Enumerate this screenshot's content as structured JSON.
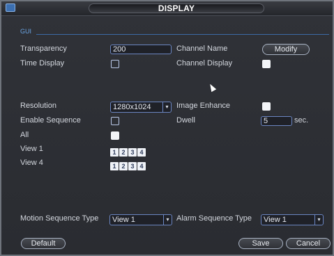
{
  "window": {
    "title": "DISPLAY"
  },
  "section": {
    "label": "GUI"
  },
  "fields": {
    "transparency": {
      "label": "Transparency",
      "value": "200"
    },
    "channel_name": {
      "label": "Channel Name",
      "button": "Modify"
    },
    "time_display": {
      "label": "Time Display",
      "checked": false
    },
    "channel_display": {
      "label": "Channel Display",
      "checked": true
    },
    "resolution": {
      "label": "Resolution",
      "value": "1280x1024"
    },
    "image_enhance": {
      "label": "Image Enhance",
      "checked": true
    },
    "enable_sequence": {
      "label": "Enable Sequence",
      "checked": false
    },
    "dwell": {
      "label": "Dwell",
      "value": "5",
      "unit": "sec."
    },
    "all": {
      "label": "All",
      "checked": true
    },
    "view1": {
      "label": "View 1",
      "channels": [
        "1",
        "2",
        "3",
        "4"
      ]
    },
    "view4": {
      "label": "View 4",
      "channels": [
        "1",
        "2",
        "3",
        "4"
      ]
    },
    "motion_sequence_type": {
      "label": "Motion Sequence Type",
      "value": "View 1"
    },
    "alarm_sequence_type": {
      "label": "Alarm Sequence Type",
      "value": "View 1"
    }
  },
  "buttons": {
    "default": "Default",
    "save": "Save",
    "cancel": "Cancel"
  },
  "icons": {
    "app": "monitor-icon",
    "dropdown": "dropdown-arrow-icon",
    "cursor": "mouse-cursor-icon"
  },
  "colors": {
    "accent": "#6ba6e6",
    "background": "#2b2e35",
    "field_border": "#6b86c2"
  }
}
